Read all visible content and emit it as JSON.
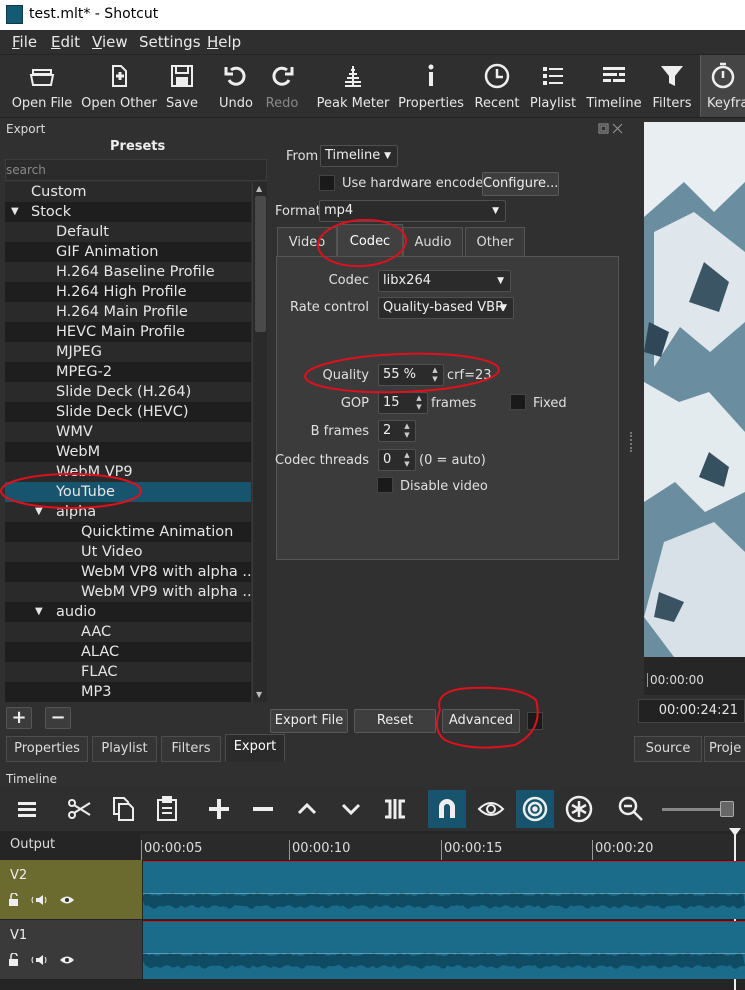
{
  "window": {
    "title": "test.mlt* - Shotcut"
  },
  "menu": [
    {
      "label": "File",
      "ul": "F",
      "rest": "ile"
    },
    {
      "label": "Edit",
      "ul": "E",
      "rest": "dit"
    },
    {
      "label": "View",
      "ul": "V",
      "rest": "iew"
    },
    {
      "label": "Settings",
      "ul": "",
      "rest": "Settings"
    },
    {
      "label": "Help",
      "ul": "H",
      "rest": "elp"
    }
  ],
  "toolbar": {
    "open_file": "Open File",
    "open_other": "Open Other",
    "save": "Save",
    "undo": "Undo",
    "redo": "Redo",
    "peak_meter": "Peak Meter",
    "properties": "Properties",
    "recent": "Recent",
    "playlist": "Playlist",
    "timeline": "Timeline",
    "filters": "Filters",
    "keyframes": "Keyfran"
  },
  "export": {
    "panel_title": "Export",
    "presets_title": "Presets",
    "search_placeholder": "search",
    "presets": [
      {
        "label": "Custom",
        "level": 1,
        "arrow": ""
      },
      {
        "label": "Stock",
        "level": 0,
        "arrow": "▼"
      },
      {
        "label": "Default",
        "level": 2,
        "arrow": ""
      },
      {
        "label": "GIF Animation",
        "level": 2,
        "arrow": ""
      },
      {
        "label": "H.264 Baseline Profile",
        "level": 2,
        "arrow": ""
      },
      {
        "label": "H.264 High Profile",
        "level": 2,
        "arrow": ""
      },
      {
        "label": "H.264 Main Profile",
        "level": 2,
        "arrow": ""
      },
      {
        "label": "HEVC Main Profile",
        "level": 2,
        "arrow": ""
      },
      {
        "label": "MJPEG",
        "level": 2,
        "arrow": ""
      },
      {
        "label": "MPEG-2",
        "level": 2,
        "arrow": ""
      },
      {
        "label": "Slide Deck (H.264)",
        "level": 2,
        "arrow": ""
      },
      {
        "label": "Slide Deck (HEVC)",
        "level": 2,
        "arrow": ""
      },
      {
        "label": "WMV",
        "level": 2,
        "arrow": ""
      },
      {
        "label": "WebM",
        "level": 2,
        "arrow": ""
      },
      {
        "label": "WebM VP9",
        "level": 2,
        "arrow": ""
      },
      {
        "label": "YouTube",
        "level": 2,
        "arrow": "",
        "selected": true
      },
      {
        "label": "alpha",
        "level": 1,
        "arrow": "▼"
      },
      {
        "label": "Quicktime Animation",
        "level": 3,
        "arrow": ""
      },
      {
        "label": "Ut Video",
        "level": 3,
        "arrow": ""
      },
      {
        "label": "WebM VP8 with alpha ...",
        "level": 3,
        "arrow": ""
      },
      {
        "label": "WebM VP9 with alpha ...",
        "level": 3,
        "arrow": ""
      },
      {
        "label": "audio",
        "level": 1,
        "arrow": "▼"
      },
      {
        "label": "AAC",
        "level": 3,
        "arrow": ""
      },
      {
        "label": "ALAC",
        "level": 3,
        "arrow": ""
      },
      {
        "label": "FLAC",
        "level": 3,
        "arrow": ""
      },
      {
        "label": "MP3",
        "level": 3,
        "arrow": ""
      }
    ],
    "add_button": "+",
    "remove_button": "−",
    "from_label": "From",
    "from_value": "Timeline",
    "hw_encoder_label": "Use hardware encoder",
    "configure_button": "Configure...",
    "format_label": "Format",
    "format_value": "mp4",
    "tabs": [
      "Video",
      "Codec",
      "Audio",
      "Other"
    ],
    "codec": {
      "codec_label": "Codec",
      "codec_value": "libx264",
      "rate_control_label": "Rate control",
      "rate_control_value": "Quality-based VBR",
      "quality_label": "Quality",
      "quality_value": "55 %",
      "crf_text": "crf=23",
      "gop_label": "GOP",
      "gop_value": "15",
      "gop_unit": "frames",
      "fixed_label": "Fixed",
      "bframes_label": "B frames",
      "bframes_value": "2",
      "threads_label": "Codec threads",
      "threads_value": "0",
      "threads_hint": "(0 = auto)",
      "disable_video_label": "Disable video"
    },
    "export_file_button": "Export File",
    "reset_button": "Reset",
    "advanced_button": "Advanced"
  },
  "player": {
    "timecode_start": "00:00:00",
    "timecode_position": "00:00:24:21"
  },
  "bottom_tabs": [
    "Properties",
    "Playlist",
    "Filters",
    "Export"
  ],
  "right_tabs": [
    "Source",
    "Proje"
  ],
  "timeline": {
    "title": "Timeline",
    "output_label": "Output",
    "ruler": [
      "00:00:05",
      "00:00:10",
      "00:00:15",
      "00:00:20"
    ],
    "tracks": [
      {
        "name": "V2",
        "color": "#6b6b2f"
      },
      {
        "name": "V1",
        "color": "#3a3a3a"
      }
    ]
  },
  "colors": {
    "accent": "#17546e",
    "annotation": "#e0101c",
    "clip": "#1a6c8a"
  }
}
